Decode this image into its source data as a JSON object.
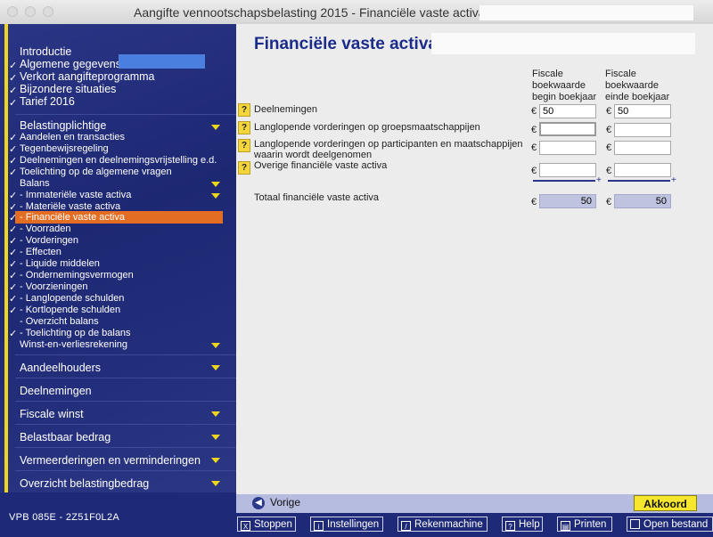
{
  "window": {
    "title": "Aangifte vennootschapsbelasting 2015 - Financiële vaste activa"
  },
  "sidebar": {
    "top_items": [
      {
        "label": "Introductie",
        "checked": false
      },
      {
        "label": "Algemene gegevens:",
        "checked": true
      },
      {
        "label": "Verkort aangifteprogramma",
        "checked": true
      },
      {
        "label": "Bijzondere situaties",
        "checked": true
      },
      {
        "label": "Tarief 2016",
        "checked": true
      }
    ],
    "section_belasting": "Belastingplichtige",
    "belasting_items": [
      {
        "label": "Aandelen en transacties",
        "checked": true
      },
      {
        "label": "Tegenbewijsregeling",
        "checked": true
      },
      {
        "label": "Deelnemingen en deelnemingsvrijstelling e.d.",
        "checked": true
      },
      {
        "label": "Toelichting op de algemene vragen",
        "checked": true
      }
    ],
    "balans_label": "Balans",
    "balans_items": [
      {
        "label": "- Immateriële vaste activa",
        "checked": true
      },
      {
        "label": "- Materiële vaste activa",
        "checked": true
      },
      {
        "label": "- Financiële vaste activa",
        "checked": true
      },
      {
        "label": "- Voorraden",
        "checked": true
      },
      {
        "label": "- Vorderingen",
        "checked": true
      },
      {
        "label": "- Effecten",
        "checked": true
      },
      {
        "label": "- Liquide middelen",
        "checked": true
      },
      {
        "label": "- Ondernemingsvermogen",
        "checked": true
      },
      {
        "label": "- Voorzieningen",
        "checked": true
      },
      {
        "label": "- Langlopende schulden",
        "checked": true
      },
      {
        "label": "- Kortlopende schulden",
        "checked": true
      },
      {
        "label": "- Overzicht balans",
        "checked": false
      },
      {
        "label": "- Toelichting op de balans",
        "checked": true
      }
    ],
    "winst_label": "Winst-en-verliesrekening",
    "sections": [
      "Aandeelhouders",
      "Deelnemingen",
      "Fiscale winst",
      "Belastbaar bedrag",
      "Vermeerderingen en verminderingen",
      "Overzicht belastingbedrag"
    ],
    "code": "VPB 085E - 2Z51F0L2A"
  },
  "main": {
    "title": "Financiële vaste activa",
    "col1": [
      "Fiscale",
      "boekwaarde",
      "begin boekjaar"
    ],
    "col2": [
      "Fiscale",
      "boekwaarde",
      "einde boekjaar"
    ],
    "currency": "€",
    "rows": [
      {
        "label": "Deelnemingen",
        "begin": "50",
        "einde": "50"
      },
      {
        "label": "Langlopende vorderingen op groepsmaatschappijen",
        "begin": "",
        "einde": ""
      },
      {
        "label": "Langlopende vorderingen op participanten en maatschappijen",
        "label2": "waarin wordt deelgenomen",
        "begin": "",
        "einde": ""
      },
      {
        "label": "Overige financiële vaste activa",
        "begin": "",
        "einde": ""
      }
    ],
    "total": {
      "label": "Totaal financiële vaste activa",
      "begin": "50",
      "einde": "50"
    },
    "plus": "+",
    "help": "?"
  },
  "nav": {
    "prev": "Vorige",
    "ok": "Akkoord"
  },
  "toolbar": [
    "Stoppen",
    "Instellingen",
    "Rekenmachine",
    "Help",
    "Printen",
    "Open bestand"
  ]
}
